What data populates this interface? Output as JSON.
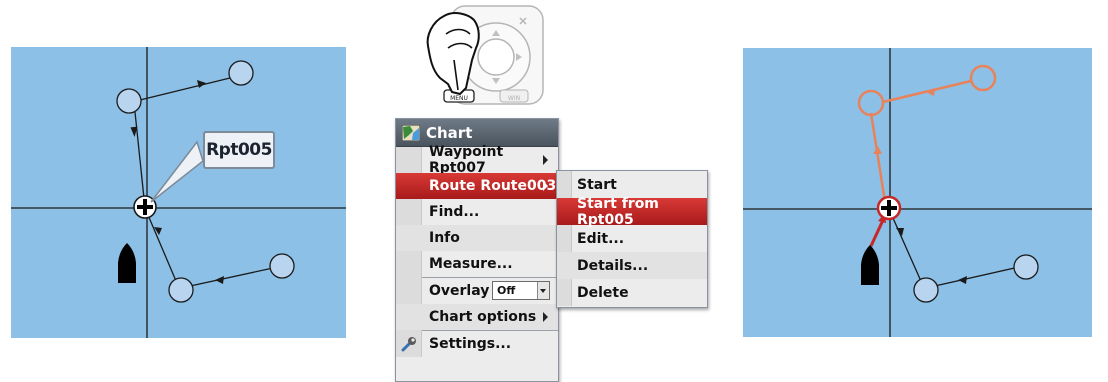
{
  "left_chart": {
    "callout_label": "Rpt005"
  },
  "keypad": {
    "menu_label": "MENU",
    "win_label": "WIN"
  },
  "menu": {
    "title": "Chart",
    "items": [
      {
        "label": "Waypoint Rpt007",
        "submenu": true
      },
      {
        "label": "Route Route003",
        "submenu": true,
        "selected": true
      },
      {
        "label": "Find..."
      },
      {
        "label": "Info"
      },
      {
        "label": "Measure..."
      },
      {
        "label": "Overlay",
        "select_value": "Off"
      },
      {
        "label": "Chart options",
        "submenu": true
      },
      {
        "label": "Settings...",
        "icon": "wrench-icon"
      }
    ]
  },
  "submenu": {
    "items": [
      {
        "label": "Start"
      },
      {
        "label": "Start from Rpt005",
        "selected": true
      },
      {
        "label": "Edit..."
      },
      {
        "label": "Details..."
      },
      {
        "label": "Delete"
      }
    ]
  },
  "colors": {
    "water": "#8cc0e6",
    "route_active": "#e8825a",
    "selection_red": "#c62828",
    "waypoint_fill": "#b8d4ee"
  }
}
